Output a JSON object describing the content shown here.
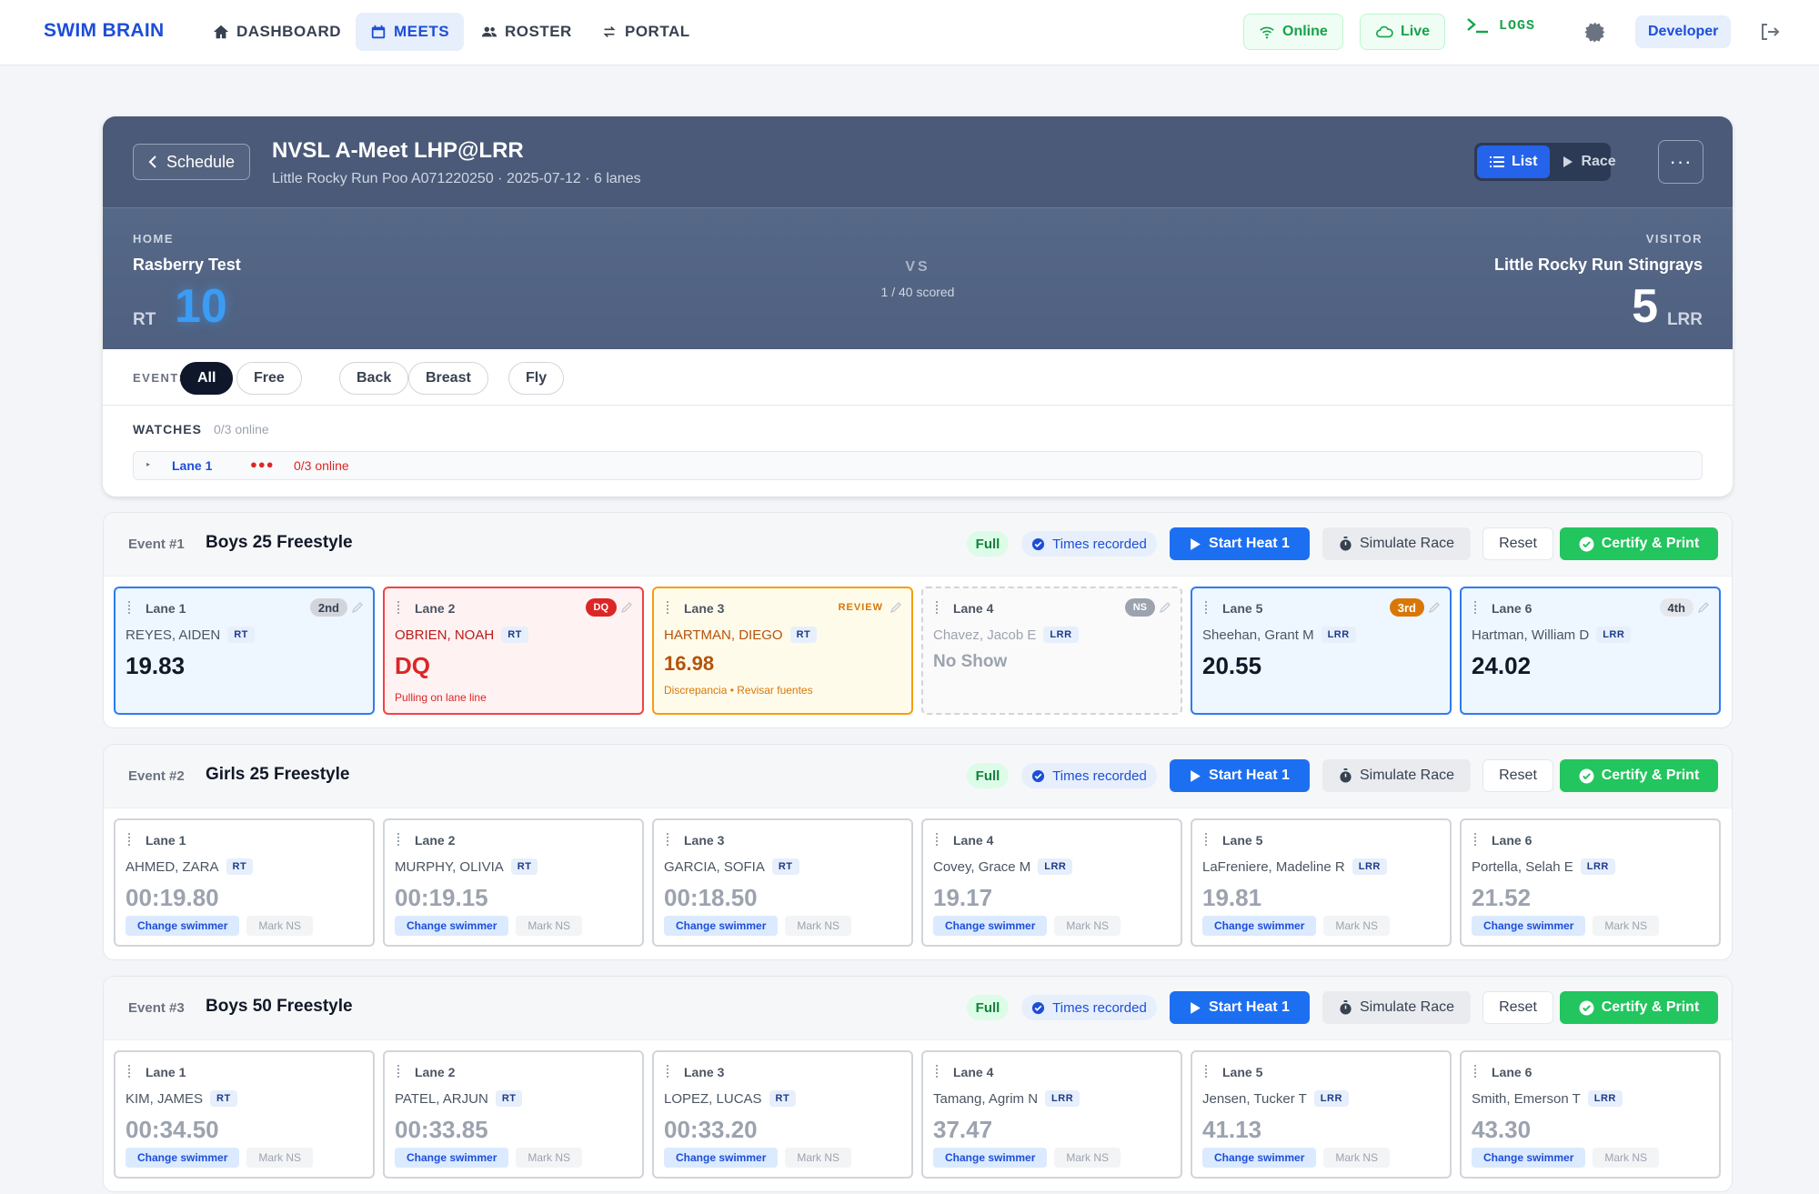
{
  "brand": "SWIM BRAIN",
  "nav": [
    {
      "label": "DASHBOARD",
      "icon": "home-icon"
    },
    {
      "label": "MEETS",
      "icon": "calendar-icon",
      "active": true
    },
    {
      "label": "ROSTER",
      "icon": "users-icon"
    },
    {
      "label": "PORTAL",
      "icon": "swap-icon"
    }
  ],
  "status": {
    "online": "Online",
    "live": "Live",
    "logs": "LOGS",
    "developer": "Developer"
  },
  "meet": {
    "back_label": "Schedule",
    "title": "NVSL A-Meet LHP@LRR",
    "subtitle": "Little Rocky Run Poo A071220250 · 2025-07-12 · 6 lanes",
    "view_list": "List",
    "view_race": "Race",
    "more": "···",
    "home_label": "HOME",
    "home_team": "Rasberry Test",
    "home_abbr": "RT",
    "home_score": "10",
    "vs": "VS",
    "scored": "1 / 40 scored",
    "visitor_label": "VISITOR",
    "visitor_team": "Little Rocky Run Stingrays",
    "visitor_abbr": "LRR",
    "visitor_score": "5"
  },
  "filters": {
    "label": "EVENTS",
    "chips": [
      "All",
      "Free",
      "Back",
      "Breast",
      "Fly"
    ],
    "selected": "All"
  },
  "watches": {
    "label": "WATCHES",
    "online": "0/3 online",
    "lane": "Lane 1",
    "dots": "●●●",
    "lane_online": "0/3 online"
  },
  "event_buttons": {
    "full": "Full",
    "times": "Times recorded",
    "start": "Start Heat 1",
    "simulate": "Simulate Race",
    "reset": "Reset",
    "certify": "Certify & Print"
  },
  "lane_actions": {
    "change": "Change swimmer",
    "mark_ns": "Mark NS"
  },
  "events": [
    {
      "num": "Event #1",
      "name": "Boys 25 Freestyle",
      "lanes": [
        {
          "lane": "Lane 1",
          "name": "REYES, AIDEN",
          "team": "RT",
          "time": "19.83",
          "place": "2nd",
          "state": "placed"
        },
        {
          "lane": "Lane 2",
          "name": "OBRIEN, NOAH",
          "team": "RT",
          "time": "DQ",
          "place": "DQ",
          "note": "Pulling on lane line",
          "state": "dq"
        },
        {
          "lane": "Lane 3",
          "name": "HARTMAN, DIEGO",
          "team": "RT",
          "time": "16.98",
          "place": "REVIEW",
          "note": "Discrepancia • Revisar fuentes",
          "state": "review"
        },
        {
          "lane": "Lane 4",
          "name": "Chavez, Jacob E",
          "team": "LRR",
          "time": "No Show",
          "place": "NS",
          "state": "ns"
        },
        {
          "lane": "Lane 5",
          "name": "Sheehan, Grant M",
          "team": "LRR",
          "time": "20.55",
          "place": "3rd",
          "state": "placed"
        },
        {
          "lane": "Lane 6",
          "name": "Hartman, William D",
          "team": "LRR",
          "time": "24.02",
          "place": "4th",
          "state": "placed"
        }
      ]
    },
    {
      "num": "Event #2",
      "name": "Girls 25 Freestyle",
      "lanes": [
        {
          "lane": "Lane 1",
          "name": "AHMED, ZARA",
          "team": "RT",
          "time": "00:19.80"
        },
        {
          "lane": "Lane 2",
          "name": "MURPHY, OLIVIA",
          "team": "RT",
          "time": "00:19.15"
        },
        {
          "lane": "Lane 3",
          "name": "GARCIA, SOFIA",
          "team": "RT",
          "time": "00:18.50"
        },
        {
          "lane": "Lane 4",
          "name": "Covey, Grace M",
          "team": "LRR",
          "time": "19.17"
        },
        {
          "lane": "Lane 5",
          "name": "LaFreniere, Madeline R",
          "team": "LRR",
          "time": "19.81"
        },
        {
          "lane": "Lane 6",
          "name": "Portella, Selah E",
          "team": "LRR",
          "time": "21.52"
        }
      ]
    },
    {
      "num": "Event #3",
      "name": "Boys 50 Freestyle",
      "lanes": [
        {
          "lane": "Lane 1",
          "name": "KIM, JAMES",
          "team": "RT",
          "time": "00:34.50"
        },
        {
          "lane": "Lane 2",
          "name": "PATEL, ARJUN",
          "team": "RT",
          "time": "00:33.85"
        },
        {
          "lane": "Lane 3",
          "name": "LOPEZ, LUCAS",
          "team": "RT",
          "time": "00:33.20"
        },
        {
          "lane": "Lane 4",
          "name": "Tamang, Agrim N",
          "team": "LRR",
          "time": "37.47"
        },
        {
          "lane": "Lane 5",
          "name": "Jensen, Tucker T",
          "team": "LRR",
          "time": "41.13"
        },
        {
          "lane": "Lane 6",
          "name": "Smith, Emerson T",
          "team": "LRR",
          "time": "43.30"
        }
      ]
    }
  ],
  "colors": {
    "accent": "#1d6ff2",
    "certify": "#22c55e",
    "dq": "#dc2626",
    "review": "#d97706",
    "home_score": "#3b9cf5"
  }
}
